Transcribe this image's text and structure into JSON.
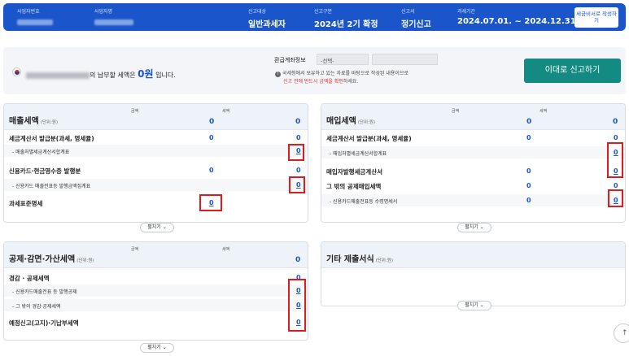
{
  "header": {
    "business_no_label": "사업자번호",
    "business_name_label": "사업자명",
    "target_label": "신고대상",
    "target_value": "일반과세자",
    "period_type_label": "신고구분",
    "period_type_value": "2024년 2기 확정",
    "report_type_label": "신고서",
    "report_type_value": "정기신고",
    "tax_period_label": "과세기간",
    "tax_period_value": "2024.07.01. ~ 2024.12.31.",
    "invoice_button": "세금비서로 작성하기"
  },
  "summary": {
    "text_before": "의 납부할 세액은",
    "amount": "0원",
    "text_after": "입니다.",
    "refund_label": "환급계좌정보",
    "refund_select": "-선택-",
    "info_line1": "국세청에서 보유하고 있는 자료를 바탕으로 작성된 내용이므로",
    "info_line2_red": "신고 전에 반드시 금액을 확인",
    "info_line2_rest": "하세요.",
    "submit_button": "이대로 신고하기"
  },
  "panels": {
    "col_amount": "금액",
    "col_tax": "세액",
    "unit": "(단위:원)",
    "fold_label": "펼치기",
    "sales": {
      "title": "매출세액",
      "head_amount": "0",
      "head_tax": "0",
      "rows": [
        {
          "label": "세금계산서 발급분(과세, 영세율)",
          "amount": "0",
          "tax": "0"
        },
        {
          "label": "- 매출처별세금계산서합계표",
          "tax": "0"
        },
        {
          "label": "신용카드·현금영수증 발행분",
          "amount": "0",
          "tax": "0"
        },
        {
          "label": "- 신용카드 매출전표등 발행금액집계표",
          "tax": "0"
        },
        {
          "label": "과세표준명세",
          "amount": "0"
        }
      ]
    },
    "purchase": {
      "title": "매입세액",
      "head_amount": "0",
      "head_tax": "0",
      "rows": [
        {
          "label": "세금계산서 발급분(과세, 영세율)",
          "amount": "0",
          "tax": "0"
        },
        {
          "label": "- 매입처별세금계산서합계표",
          "tax": "0"
        },
        {
          "label": "매입자발행세금계산서",
          "amount": "0",
          "tax": "0"
        },
        {
          "label": "그 밖의 공제매입세액",
          "amount": "0",
          "tax": "0"
        },
        {
          "label": "- 신용카드매출전표등 수령명세서",
          "amount": "0",
          "tax": "0"
        }
      ]
    },
    "deduction": {
      "title": "공제·감면·가산세액",
      "head_tax": "0",
      "rows": [
        {
          "label": "경감 · 공제세액",
          "tax": "0"
        },
        {
          "label": "- 신용카드매출전표 등 발행공제",
          "tax": "0"
        },
        {
          "label": "- 그 밖의 경감·공제세액",
          "tax": "0"
        },
        {
          "label": "예정신고(고지)·기납부세액",
          "tax": "0"
        }
      ]
    },
    "other": {
      "title": "기타 제출서식"
    }
  },
  "scroll_top": "↑"
}
